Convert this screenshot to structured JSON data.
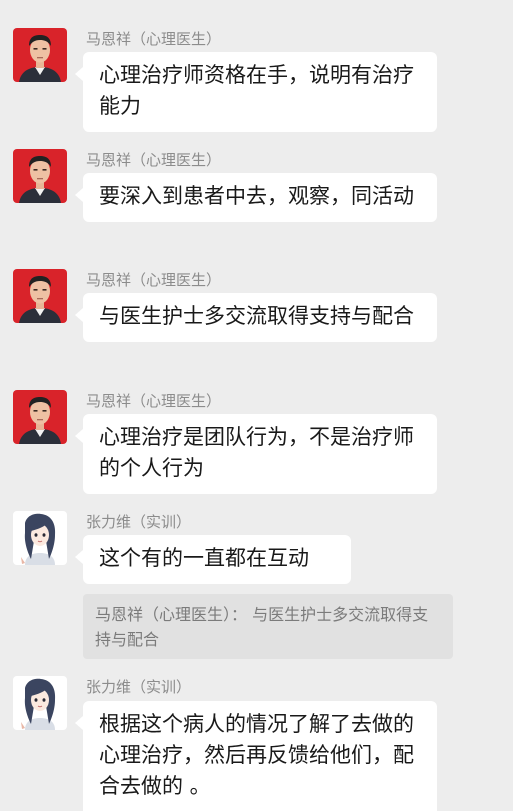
{
  "messages": [
    {
      "sender": "马恩祥（心理医生）",
      "text": "心理治疗师资格在手，说明有治疗能力",
      "avatar": "male-doctor-avatar"
    },
    {
      "sender": "马恩祥（心理医生）",
      "text": "要深入到患者中去，观察，同活动",
      "avatar": "male-doctor-avatar"
    },
    {
      "sender": "马恩祥（心理医生）",
      "text": "与医生护士多交流取得支持与配合",
      "avatar": "male-doctor-avatar"
    },
    {
      "sender": "马恩祥（心理医生）",
      "text": "心理治疗是团队行为，不是治疗师的个人行为",
      "avatar": "male-doctor-avatar"
    },
    {
      "sender": "张力维（实训）",
      "text": "这个有的一直都在互动",
      "avatar": "female-cartoon-avatar",
      "quote": "马恩祥（心理医生）： 与医生护士多交流取得支持与配合"
    },
    {
      "sender": "张力维（实训）",
      "text": "根据这个病人的情况了解了去做的心理治疗，然后再反馈给他们，配合去做的 。",
      "avatar": "female-cartoon-avatar"
    }
  ]
}
